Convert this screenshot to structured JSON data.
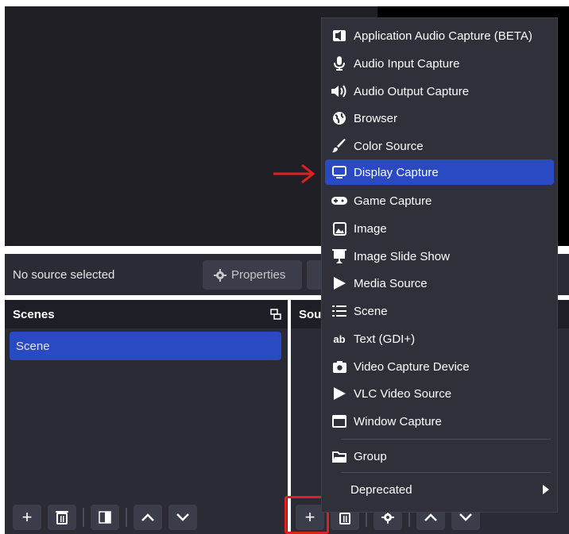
{
  "context_bar": {
    "status": "No source selected",
    "properties_label": "Properties"
  },
  "scenes_dock": {
    "title": "Scenes",
    "items": [
      "Scene"
    ]
  },
  "sources_dock": {
    "title_partial": "Sou"
  },
  "add_source_menu": {
    "items": [
      {
        "label": "Application Audio Capture (BETA)",
        "icon": "app-audio-icon"
      },
      {
        "label": "Audio Input Capture",
        "icon": "microphone-icon"
      },
      {
        "label": "Audio Output Capture",
        "icon": "speaker-icon"
      },
      {
        "label": "Browser",
        "icon": "globe-icon"
      },
      {
        "label": "Color Source",
        "icon": "paintbrush-icon"
      },
      {
        "label": "Display Capture",
        "icon": "monitor-icon",
        "selected": true
      },
      {
        "label": "Game Capture",
        "icon": "gamepad-icon"
      },
      {
        "label": "Image",
        "icon": "image-icon"
      },
      {
        "label": "Image Slide Show",
        "icon": "slideshow-icon"
      },
      {
        "label": "Media Source",
        "icon": "play-icon"
      },
      {
        "label": "Scene",
        "icon": "list-icon"
      },
      {
        "label": "Text (GDI+)",
        "icon": "text-icon"
      },
      {
        "label": "Video Capture Device",
        "icon": "camera-icon"
      },
      {
        "label": "VLC Video Source",
        "icon": "play-icon"
      },
      {
        "label": "Window Capture",
        "icon": "window-icon"
      }
    ],
    "group_label": "Group",
    "deprecated_label": "Deprecated"
  },
  "colors": {
    "accent": "#2a4ac3",
    "dock_bg": "#2a2b35",
    "menu_bg": "#2f303a",
    "highlight_red": "#e02020"
  }
}
